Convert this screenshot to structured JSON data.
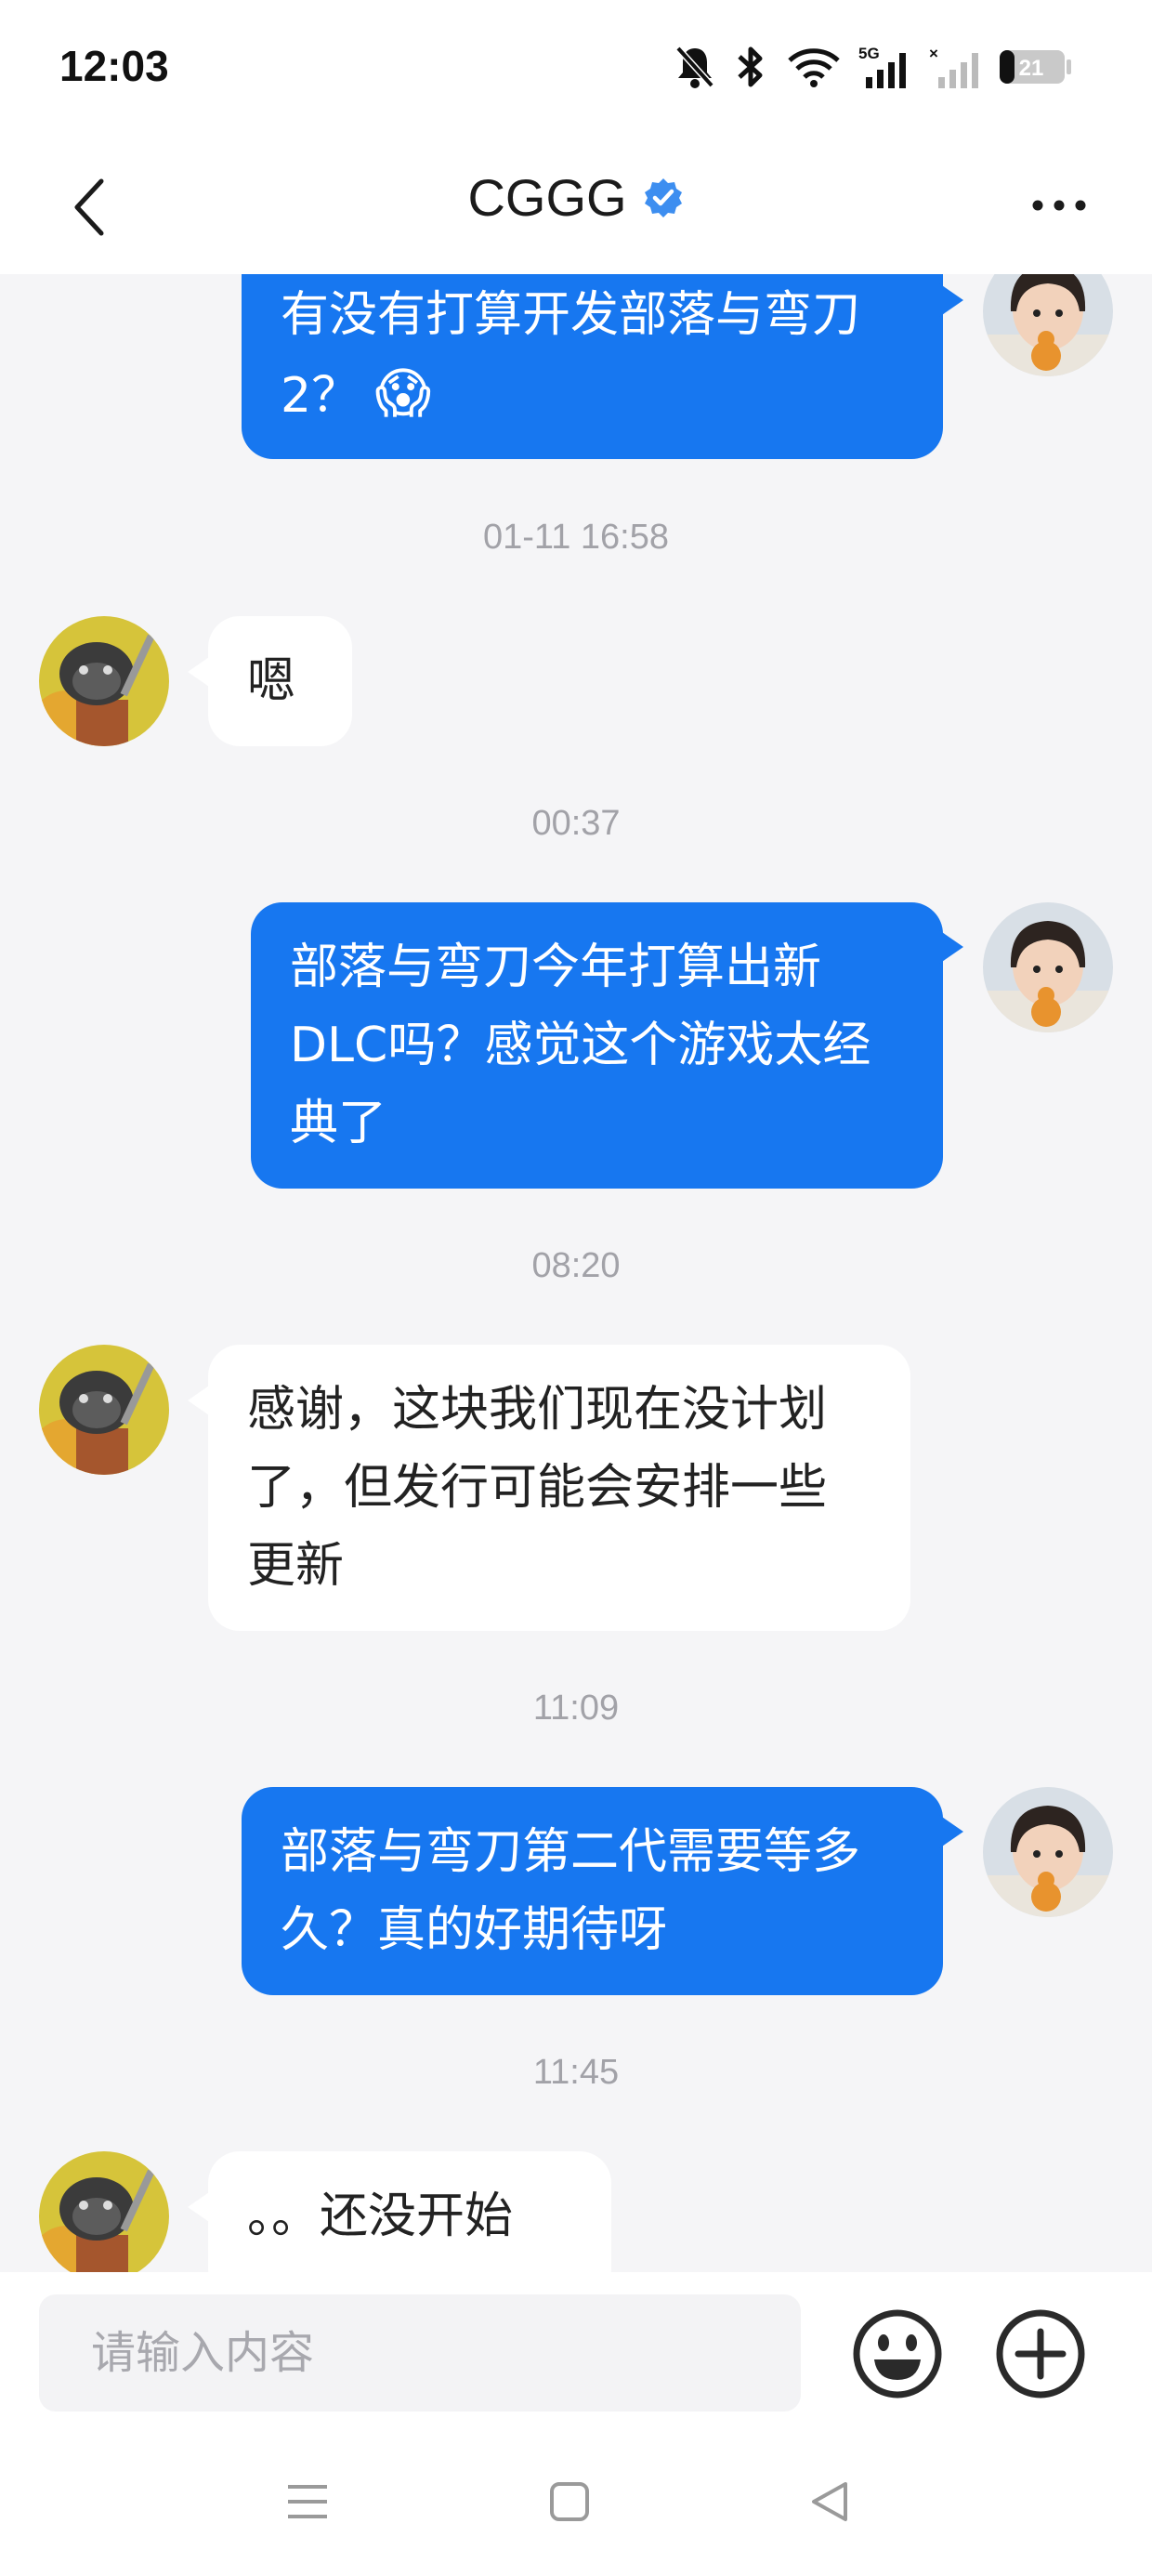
{
  "status_bar": {
    "time": "12:03",
    "network": "5G",
    "battery": "21"
  },
  "header": {
    "title": "CGGG",
    "icons": [
      "back-icon",
      "verified-badge-icon",
      "more-icon"
    ]
  },
  "messages": [
    {
      "type": "message",
      "side": "out",
      "lines": [
        "有没有打算开发部落与弯刀",
        "2？"
      ],
      "emoji": "😱"
    },
    {
      "type": "timestamp",
      "text": "01-11 16:58"
    },
    {
      "type": "message",
      "side": "in",
      "lines": [
        "嗯"
      ]
    },
    {
      "type": "timestamp",
      "text": "00:37"
    },
    {
      "type": "message",
      "side": "out",
      "lines": [
        "部落与弯刀今年打算出新",
        "DLC吗？感觉这个游戏太经",
        "典了"
      ]
    },
    {
      "type": "timestamp",
      "text": "08:20"
    },
    {
      "type": "message",
      "side": "in",
      "lines": [
        "感谢，这块我们现在没计划",
        "了，但发行可能会安排一些",
        "更新"
      ]
    },
    {
      "type": "timestamp",
      "text": "11:09"
    },
    {
      "type": "message",
      "side": "out",
      "lines": [
        "部落与弯刀第二代需要等多",
        "久？真的好期待呀"
      ]
    },
    {
      "type": "timestamp",
      "text": "11:45"
    },
    {
      "type": "message",
      "side": "in",
      "lines": [
        "。。还没开始"
      ]
    }
  ],
  "input": {
    "placeholder": "请输入内容",
    "icons": [
      "emoji-icon",
      "plus-icon"
    ]
  },
  "colors": {
    "outgoing_bubble": "#1777f0",
    "incoming_bubble": "#ffffff",
    "verified_badge": "#3d8ef0"
  }
}
